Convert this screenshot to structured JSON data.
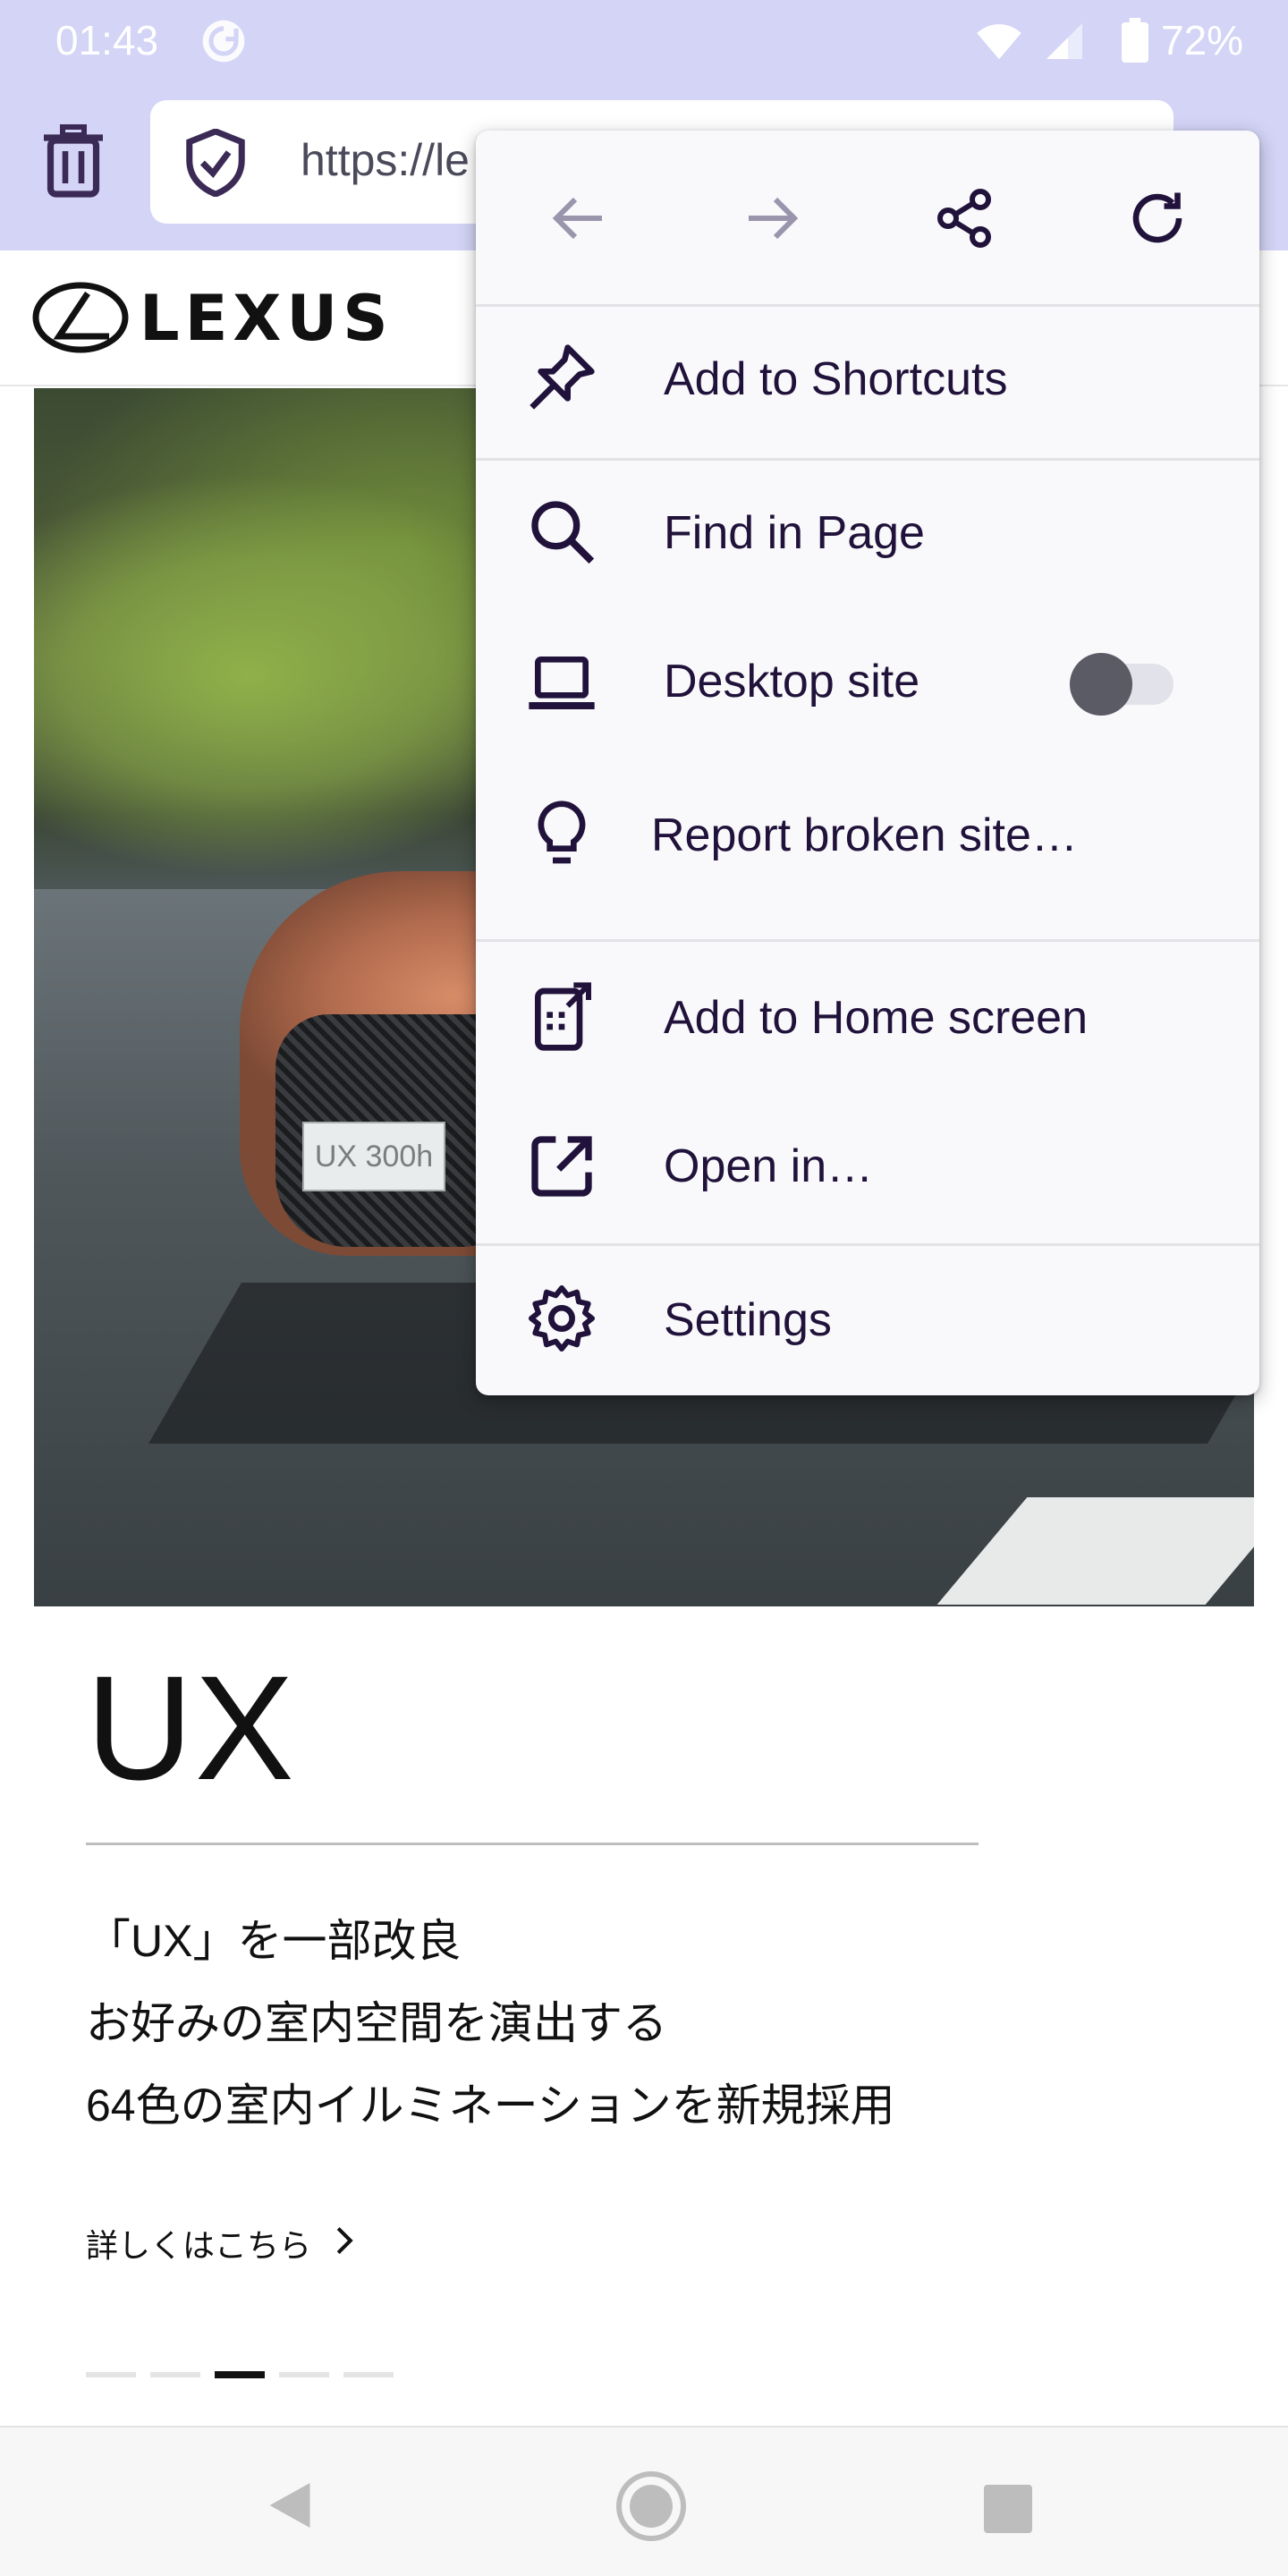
{
  "status_bar": {
    "time": "01:43",
    "battery": "72%",
    "icons": [
      "sync-icon",
      "wifi-icon",
      "signal-icon",
      "battery-icon"
    ]
  },
  "toolbar": {
    "url": "https://le",
    "icons": [
      "trash-icon",
      "shield-icon"
    ]
  },
  "site": {
    "brand": "LEXUS",
    "hero_plate": "UX 300h",
    "model_title": "UX",
    "desc_lines": [
      "「UX」を一部改良",
      "お好みの室内空間を演出する",
      "64色の室内イルミネーションを新規採用"
    ],
    "more_link": "詳しくはこちら",
    "carousel": {
      "count": 5,
      "active_index": 2
    }
  },
  "menu": {
    "nav_icons": [
      "back-arrow-icon",
      "forward-arrow-icon",
      "share-icon",
      "reload-icon"
    ],
    "items": [
      {
        "label": "Add to Shortcuts",
        "icon": "pin-icon"
      },
      {
        "label": "Find in Page",
        "icon": "search-icon"
      },
      {
        "label": "Desktop site",
        "icon": "laptop-icon",
        "toggle_on": false
      },
      {
        "label": "Report broken site…",
        "icon": "lightbulb-icon"
      },
      {
        "label": "Add to Home screen",
        "icon": "add-to-home-icon"
      },
      {
        "label": "Open in…",
        "icon": "open-external-icon"
      },
      {
        "label": "Settings",
        "icon": "gear-icon"
      }
    ]
  },
  "nav_bar": {
    "icons": [
      "back-triangle-icon",
      "home-circle-icon",
      "recents-square-icon"
    ]
  },
  "colors": {
    "chrome": "#d3d4f6",
    "menu_text": "#20123a",
    "menu_bg": "#f9f9fb"
  }
}
